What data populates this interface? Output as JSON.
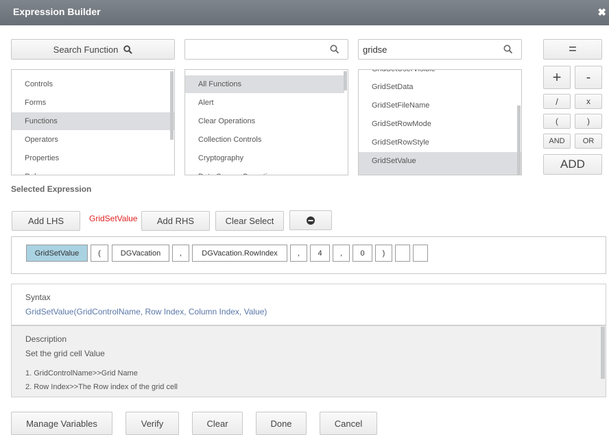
{
  "window": {
    "title": "Expression Builder",
    "close": "✖"
  },
  "search_function": {
    "label": "Search Function"
  },
  "search2": {
    "value": ""
  },
  "search3": {
    "value": "gridse"
  },
  "categories": [
    "Controls",
    "Forms",
    "Functions",
    "Operators",
    "Properties",
    "Rules"
  ],
  "groups": [
    "All Functions",
    "Alert",
    "Clear Operations",
    "Collection Controls",
    "Cryptography",
    "Data Source Operations"
  ],
  "functions": [
    "GridSetUserVisible",
    "GridSetData",
    "GridSetFileName",
    "GridSetRowMode",
    "GridSetRowStyle",
    "GridSetValue"
  ],
  "operators": {
    "equals": "=",
    "plus": "+",
    "minus": "-",
    "divide": "/",
    "multiply": "x",
    "lparen": "(",
    "rparen": ")",
    "and": "AND",
    "or": "OR",
    "add": "ADD"
  },
  "selected_expression": {
    "label": "Selected Expression",
    "add_lhs": "Add LHS",
    "current": "GridSetValue",
    "add_rhs": "Add RHS",
    "clear_select": "Clear Select"
  },
  "tokens": [
    "GridSetValue",
    "(",
    "DGVacation",
    ",",
    "DGVacation.RowIndex",
    ",",
    "4",
    ",",
    "0",
    ")",
    "",
    ""
  ],
  "syntax": {
    "heading": "Syntax",
    "text": "GridSetValue(GridControlName, Row Index, Column Index, Value)"
  },
  "description": {
    "heading": "Description",
    "text": "Set the grid cell Value",
    "lines": [
      "1. GridControlName>>Grid Name",
      "2. Row Index>>The Row index of the grid cell"
    ]
  },
  "footer": {
    "manage": "Manage Variables",
    "verify": "Verify",
    "clear": "Clear",
    "done": "Done",
    "cancel": "Cancel"
  },
  "colors": {
    "titlebar": "#73797f",
    "selected_token": "#a9d2e2",
    "selected_item": "#dcdde0",
    "current_fn": "#e02020",
    "syntax": "#5a77a8"
  }
}
